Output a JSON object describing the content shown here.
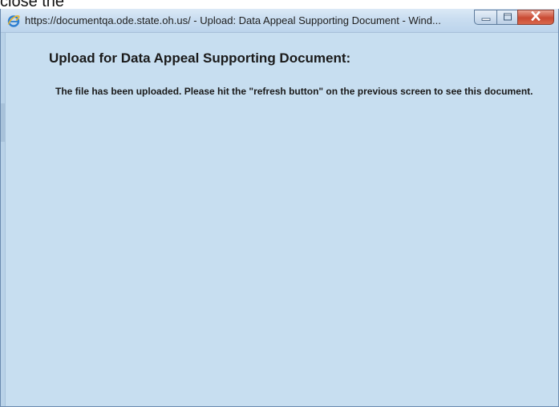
{
  "background_text": "close the",
  "window": {
    "title": "https://documentqa.ode.state.oh.us/ - Upload: Data Appeal Supporting Document - Wind...",
    "controls": {
      "minimize_icon": "minimize-icon",
      "maximize_icon": "maximize-icon",
      "close_icon": "close-icon"
    },
    "app_icon": "internet-explorer-icon"
  },
  "page": {
    "heading": "Upload for Data Appeal Supporting Document:",
    "message": "The file has been uploaded. Please hit the \"refresh button\" on the previous screen to see this document."
  },
  "colors": {
    "content_background": "#c7def0",
    "titlebar_top": "#dbe9f6",
    "close_button": "#c94a33",
    "text": "#1a1a1a"
  }
}
